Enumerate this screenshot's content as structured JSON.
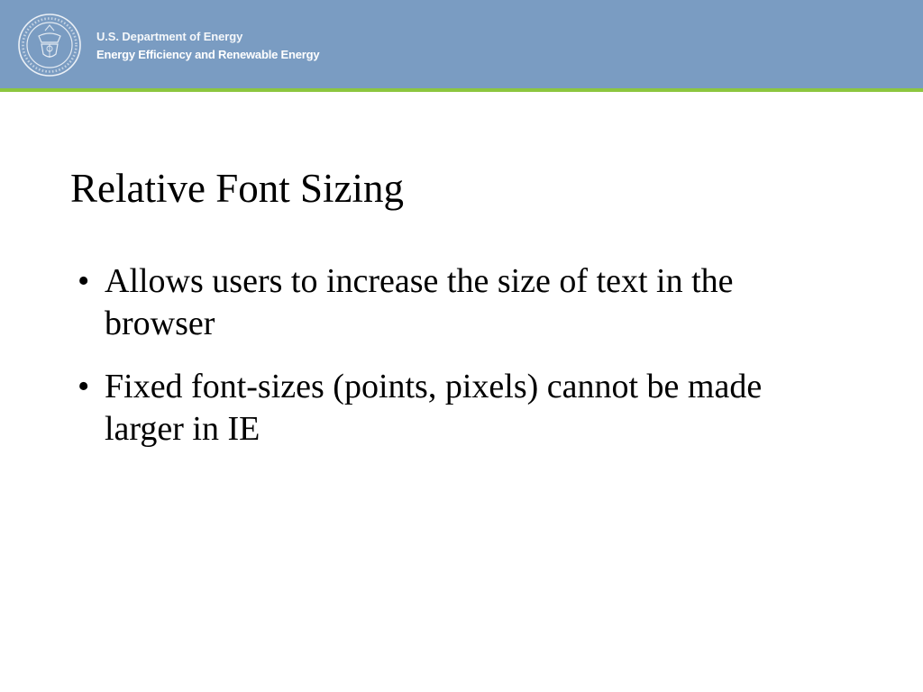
{
  "header": {
    "department": "U.S. Department of Energy",
    "office": "Energy Efficiency and Renewable Energy",
    "seal_icon": "doe-seal-icon",
    "colors": {
      "band": "#7a9cc2",
      "rule": "#8cc63f"
    }
  },
  "slide": {
    "title": "Relative Font Sizing",
    "bullet_glyph": "•",
    "bullets": [
      "Allows users to increase the size of text in the browser",
      "Fixed font-sizes (points, pixels) cannot be made larger in IE"
    ]
  }
}
